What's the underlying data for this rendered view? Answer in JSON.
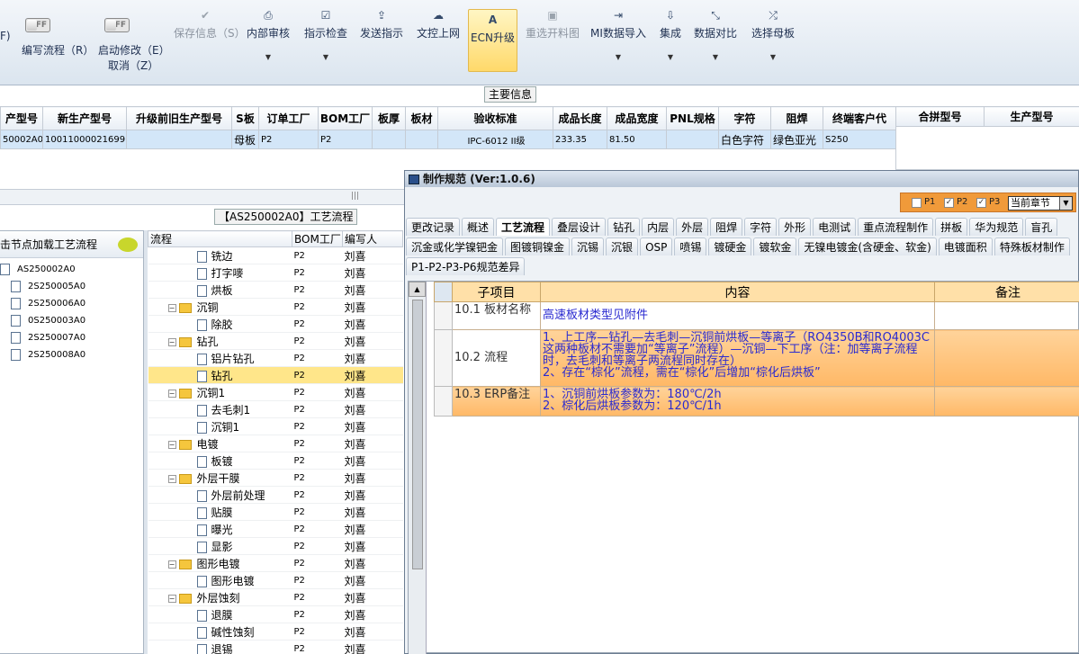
{
  "toolbar": {
    "toggles": [
      {
        "label": "OFF"
      },
      {
        "label": "OFF"
      }
    ],
    "left_edge_label": "F)",
    "write_flow_label": "编写流程（R）",
    "start_modify_label": "启动修改（E）",
    "cancel_label": "取消（Z）",
    "buttons": [
      {
        "label": "保存信息（S）",
        "icon": "check-icon",
        "enabled": false
      },
      {
        "label": "内部审核",
        "icon": "print-icon",
        "enabled": true
      },
      {
        "label": "指示检查",
        "icon": "checkbox-icon",
        "enabled": true
      },
      {
        "label": "发送指示",
        "icon": "upload-icon",
        "enabled": true
      },
      {
        "label": "文控上网",
        "icon": "cloud-upload-icon",
        "enabled": true
      },
      {
        "label": "ECN升级",
        "icon": "font-a-icon",
        "enabled": true,
        "active": true
      },
      {
        "label": "重选开料图",
        "icon": "image-icon",
        "enabled": false
      },
      {
        "label": "MI数据导入",
        "icon": "sign-in-icon",
        "enabled": true
      },
      {
        "label": "集成",
        "icon": "download-icon",
        "enabled": true
      },
      {
        "label": "数据对比",
        "icon": "compress-icon",
        "enabled": true
      },
      {
        "label": "选择母板",
        "icon": "shuffle-icon",
        "enabled": true
      }
    ]
  },
  "main_info": {
    "title": "主要信息",
    "columns": [
      "产型号",
      "新生产型号",
      "升级前旧生产型号",
      "S板",
      "订单工厂",
      "BOM工厂",
      "板厚",
      "板材",
      "验收标准",
      "成品长度",
      "成品宽度",
      "PNL规格",
      "字符",
      "阻焊",
      "终端客户代"
    ],
    "row": [
      "50002A0",
      "10011000021699",
      "",
      "母板",
      "P2",
      "P2",
      "",
      "",
      "IPC-6012 II级",
      "233.35",
      "81.50",
      "",
      "白色字符",
      "绿色亚光",
      "S250"
    ]
  },
  "side_grid": {
    "columns": [
      "合拼型号",
      "生产型号"
    ]
  },
  "process": {
    "title": "【AS250002A0】工艺流程",
    "tree_header": "击节点加载工艺流程",
    "tree_items": [
      {
        "label": "AS250002A0",
        "level": 0
      },
      {
        "label": "2S250005A0",
        "level": 1
      },
      {
        "label": "2S250006A0",
        "level": 1
      },
      {
        "label": "0S250003A0",
        "level": 1
      },
      {
        "label": "2S250007A0",
        "level": 1
      },
      {
        "label": "2S250008A0",
        "level": 1
      }
    ],
    "columns": [
      "流程",
      "BOM工厂",
      "编写人"
    ],
    "rows": [
      {
        "name": "铣边",
        "type": "leaf",
        "bom": "P2",
        "author": "刘喜"
      },
      {
        "name": "打字嘜",
        "type": "leaf",
        "bom": "P2",
        "author": "刘喜"
      },
      {
        "name": "烘板",
        "type": "leaf",
        "bom": "P2",
        "author": "刘喜"
      },
      {
        "name": "沉铜",
        "type": "folder",
        "bom": "P2",
        "author": "刘喜"
      },
      {
        "name": "除胶",
        "type": "leaf",
        "bom": "P2",
        "author": "刘喜"
      },
      {
        "name": "钻孔",
        "type": "folder",
        "bom": "P2",
        "author": "刘喜"
      },
      {
        "name": "铝片钻孔",
        "type": "leaf",
        "bom": "P2",
        "author": "刘喜"
      },
      {
        "name": "钻孔",
        "type": "leaf",
        "bom": "P2",
        "author": "刘喜",
        "selected": true
      },
      {
        "name": "沉铜1",
        "type": "folder",
        "bom": "P2",
        "author": "刘喜"
      },
      {
        "name": "去毛刺1",
        "type": "leaf",
        "bom": "P2",
        "author": "刘喜"
      },
      {
        "name": "沉铜1",
        "type": "leaf",
        "bom": "P2",
        "author": "刘喜"
      },
      {
        "name": "电镀",
        "type": "folder",
        "bom": "P2",
        "author": "刘喜"
      },
      {
        "name": "板镀",
        "type": "leaf",
        "bom": "P2",
        "author": "刘喜"
      },
      {
        "name": "外层干膜",
        "type": "folder",
        "bom": "P2",
        "author": "刘喜"
      },
      {
        "name": "外层前处理",
        "type": "leaf",
        "bom": "P2",
        "author": "刘喜"
      },
      {
        "name": "贴膜",
        "type": "leaf",
        "bom": "P2",
        "author": "刘喜"
      },
      {
        "name": "曝光",
        "type": "leaf",
        "bom": "P2",
        "author": "刘喜"
      },
      {
        "name": "显影",
        "type": "leaf",
        "bom": "P2",
        "author": "刘喜"
      },
      {
        "name": "图形电镀",
        "type": "folder",
        "bom": "P2",
        "author": "刘喜"
      },
      {
        "name": "图形电镀",
        "type": "leaf",
        "bom": "P2",
        "author": "刘喜"
      },
      {
        "name": "外层蚀刻",
        "type": "folder",
        "bom": "P2",
        "author": "刘喜"
      },
      {
        "name": "退膜",
        "type": "leaf",
        "bom": "P2",
        "author": "刘喜"
      },
      {
        "name": "碱性蚀刻",
        "type": "leaf",
        "bom": "P2",
        "author": "刘喜"
      },
      {
        "name": "退锡",
        "type": "leaf",
        "bom": "P2",
        "author": "刘喜"
      }
    ]
  },
  "dialog": {
    "title": "制作规范 (Ver:1.0.6)",
    "filters": [
      {
        "label": "P1",
        "checked": false
      },
      {
        "label": "P2",
        "checked": true
      },
      {
        "label": "P3",
        "checked": true
      }
    ],
    "chapter_select": "当前章节",
    "tabs_row1": [
      {
        "label": "更改记录"
      },
      {
        "label": "概述"
      },
      {
        "label": "工艺流程",
        "active": true
      },
      {
        "label": "叠层设计"
      },
      {
        "label": "钻孔"
      },
      {
        "label": "内层"
      },
      {
        "label": "外层"
      },
      {
        "label": "阻焊"
      },
      {
        "label": "字符"
      },
      {
        "label": "外形"
      },
      {
        "label": "电测试"
      },
      {
        "label": "重点流程制作"
      },
      {
        "label": "拼板"
      },
      {
        "label": "华为规范"
      },
      {
        "label": "盲孔"
      }
    ],
    "tabs_row2": [
      {
        "label": "沉金或化学镍钯金"
      },
      {
        "label": "图镀铜镍金"
      },
      {
        "label": "沉锡"
      },
      {
        "label": "沉银"
      },
      {
        "label": "OSP"
      },
      {
        "label": "喷锡"
      },
      {
        "label": "镀硬金"
      },
      {
        "label": "镀软金"
      },
      {
        "label": "无镍电镀金(含硬金、软金)"
      },
      {
        "label": "电镀面积"
      },
      {
        "label": "特殊板材制作"
      }
    ],
    "tabs_row3": [
      {
        "label": "P1-P2-P3-P6规范差异"
      }
    ],
    "spec_columns": [
      "子项目",
      "内容",
      "备注"
    ],
    "spec_rows": [
      {
        "item": "10.1 板材名称",
        "content": "高速板材类型见附件",
        "note": ""
      },
      {
        "item": "10.2 流程",
        "content": "1、上工序—钻孔—去毛刺—沉铜前烘板—等离子（RO4350B和RO4003C这两种板材不需要加“等离子”流程）—沉铜—下工序（注：加等离子流程时，去毛刺和等离子两流程同时存在）\n2、存在“棕化”流程，需在“棕化”后增加“棕化后烘板”",
        "note": ""
      },
      {
        "item": "10.3 ERP备注",
        "content": "1、沉铜前烘板参数为：180℃/2h\n2、棕化后烘板参数为：120℃/1h",
        "note": ""
      }
    ]
  }
}
